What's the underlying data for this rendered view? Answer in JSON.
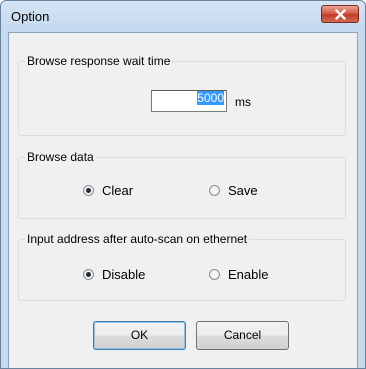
{
  "window": {
    "title": "Option"
  },
  "browse_response": {
    "group_label": "Browse response wait time",
    "value": "5000",
    "unit": "ms"
  },
  "browse_data": {
    "group_label": "Browse data",
    "options": [
      {
        "label": "Clear",
        "selected": true
      },
      {
        "label": "Save",
        "selected": false
      }
    ]
  },
  "input_address": {
    "group_label": "Input address after auto-scan on ethernet",
    "options": [
      {
        "label": "Disable",
        "selected": true
      },
      {
        "label": "Enable",
        "selected": false
      }
    ]
  },
  "buttons": {
    "ok_label": "OK",
    "cancel_label": "Cancel"
  },
  "icons": {
    "close": "close-icon"
  }
}
